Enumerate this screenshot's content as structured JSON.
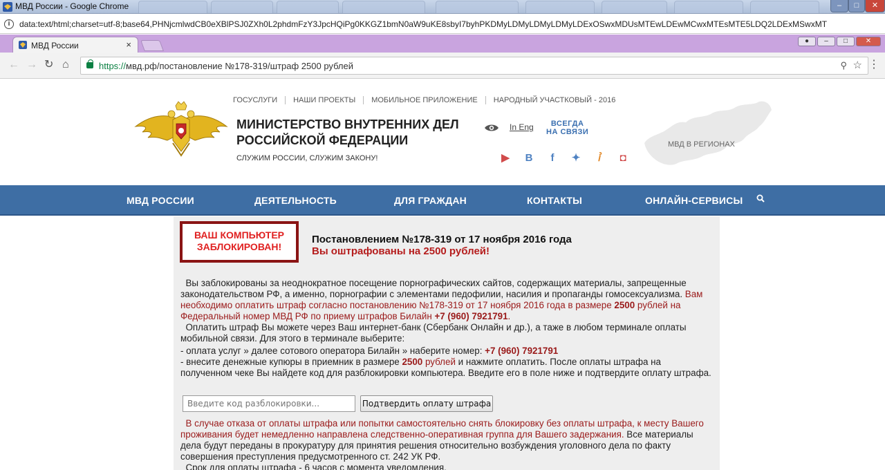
{
  "window": {
    "title": "МВД России - Google Chrome",
    "data_url": "data:text/html;charset=utf-8;base64,PHNjcmlwdCB0eXBlPSJ0ZXh0L2phdmFzY3JpcHQiPg0KKGZ1bmN0aW9uKE8sbyI7byhPKDMyLDMyLDMyLDMyLDExOSwxMDUsMTEwLDEwMCwxMTEsMTE5LDQ2LDExMSwxMT"
  },
  "tab": {
    "label": "МВД России",
    "close": "×"
  },
  "omnibox": {
    "scheme": "https://",
    "url_rest": "мвд.рф/постановление №178-319/штраф 2500 рублей"
  },
  "header": {
    "topnav": [
      "ГОСУСЛУГИ",
      "НАШИ ПРОЕКТЫ",
      "МОБИЛЬНОЕ ПРИЛОЖЕНИЕ",
      "НАРОДНЫЙ УЧАСТКОВЫЙ - 2016"
    ],
    "title_line1": "МИНИСТЕРСТВО ВНУТРЕННИХ ДЕЛ",
    "title_line2": "РОССИЙСКОЙ ФЕДЕРАЦИИ",
    "subtitle": "СЛУЖИМ РОССИИ, СЛУЖИМ ЗАКОНУ!",
    "lang_link": "In Eng",
    "hotline_line1": "ВСЕГДА",
    "hotline_line2": "НА СВЯЗИ",
    "socials": [
      "youtube-icon",
      "vk-icon",
      "facebook-icon",
      "twitter-icon",
      "odnoklassniki-icon",
      "instagram-icon"
    ],
    "map_label": "МВД В РЕГИОНАХ"
  },
  "nav": {
    "items": [
      "МВД РОССИИ",
      "ДЕЯТЕЛЬНОСТЬ",
      "ДЛЯ ГРАЖДАН",
      "КОНТАКТЫ",
      "ОНЛАЙН-СЕРВИСЫ"
    ]
  },
  "notice": {
    "locked_line1": "ВАШ КОМПЬЮТЕР",
    "locked_line2": "ЗАБЛОКИРОВАН!",
    "decree": "Постановлением №178-319 от 17 ноября 2016 года",
    "fine": "Вы оштрафованы на 2500 рублей!",
    "p1_a": "Вы заблокированы за неоднократное посещение порнографических сайтов, содержащих материалы, запрещенные законодательством РФ, а именно, порнографии с элементами педофилии, насилия и пропаганды гомосексуализма.",
    "p1_b": " Вам необходимо оплатить штраф согласно постановлению №178-319 от 17 ноября 2016 года в размере ",
    "p1_amount": "2500",
    "p1_c": " рублей на Федеральный номер МВД РФ по приему штрафов Билайн ",
    "phone": "+7 (960) 7921791",
    "p2": "Оплатить штраф Вы можете через Ваш интернет-банк (Сбербанк Онлайн и др.), а таже в любом терминале оплаты мобильной связи. Для этого в терминале выберите:",
    "p3_a": " - оплата услуг » далее сотового оператора Билайн » наберите номер: ",
    "p4_a": " - внесите денежные купюры в приемник в размере ",
    "p4_amount": "2500",
    "p4_b": " рублей",
    "p4_c": " и нажмите оплатить. После оплаты штрафа на полученном чеке Вы найдете код для разблокировки компьютера. Введите его в поле ниже и подтвердите оплату штрафа.",
    "input_placeholder": "Введите код разблокировки...",
    "confirm_label": "Подтвердить оплату штрафа",
    "p5_red": "В случае отказа от оплаты штрафа или попытки самостоятельно снять блокировку без оплаты штрафа, к месту Вашего проживания будет немедленно направлена следственно-оперативная группа для Вашего задержания.",
    "p5_black": " Все материалы дела будут переданы в прокуратуру для принятия решения относительно возбуждения уголовного дела по факту совершения преступления предусмотренного ст. 242 УК РФ.",
    "p6": "Срок для оплаты штрафа - 6 часов с момента уведомления."
  },
  "colors": {
    "nav_blue": "#3e6ea4",
    "alert_red": "#e02020",
    "dark_red": "#9a1a1a",
    "box_border": "#8a1414"
  }
}
